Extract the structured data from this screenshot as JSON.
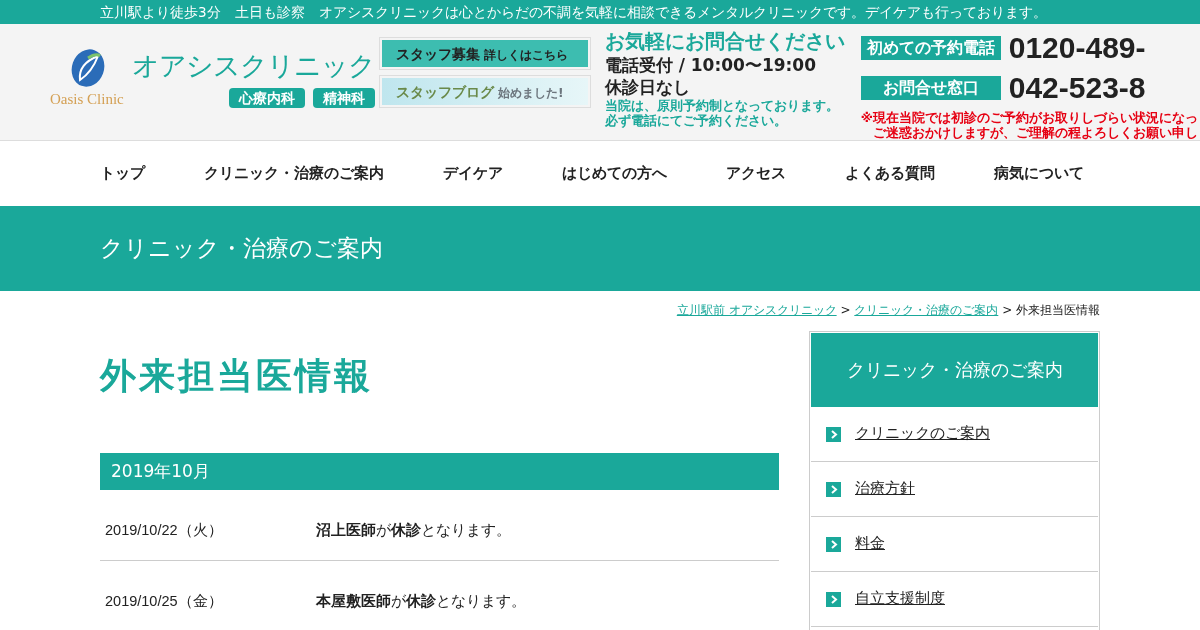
{
  "top_bar": {
    "text": "立川駅より徒歩3分　土日も診察　オアシスクリニックは心とからだの不調を気軽に相談できるメンタルクリニックです。デイケアも行っております。"
  },
  "header": {
    "logo_name": "オアシスクリニック",
    "logo_sub": "Oasis Clinic",
    "departments": [
      "心療内科",
      "精神科"
    ],
    "banners": [
      {
        "kind": "recruit",
        "title": "スタッフ募集",
        "sub": "詳しくはこちら"
      },
      {
        "kind": "blog",
        "title": "スタッフブログ",
        "sub": "始めました!"
      }
    ],
    "contact_heading": "お気軽にお問合せください",
    "hours": "電話受付 / 10:00〜19:00",
    "closed": "休診日なし",
    "note": [
      "当院は、原則予約制となっております。",
      "必ず電話にてご予約ください。"
    ],
    "phones": [
      {
        "label": "初めての予約電話",
        "number": "0120-489-"
      },
      {
        "label": "お問合せ窓口",
        "number": "042-523-8"
      }
    ],
    "warning": [
      "※現在当院では初診のご予約がお取りしづらい状況になっ",
      "ご迷惑おかけしますが、ご理解の程よろしくお願い申し"
    ]
  },
  "nav": [
    "トップ",
    "クリニック・治療のご案内",
    "デイケア",
    "はじめての方へ",
    "アクセス",
    "よくある質問",
    "病気について"
  ],
  "page_title": "クリニック・治療のご案内",
  "breadcrumb": {
    "separator": ">",
    "links": [
      "立川駅前 オアシスクリニック",
      "クリニック・治療のご案内"
    ],
    "current": "外来担当医情報"
  },
  "heading": "外来担当医情報",
  "month": "2019年10月",
  "rows": [
    {
      "date": "2019/10/22（火）",
      "text": "**沼上医師**が**休診**となります。"
    },
    {
      "date": "2019/10/25（金）",
      "text": "**本屋敷医師**が**休診**となります。"
    }
  ],
  "sidebar": {
    "title": "クリニック・治療のご案内",
    "items": [
      "クリニックのご案内",
      "治療方針",
      "料金",
      "自立支援制度"
    ]
  }
}
